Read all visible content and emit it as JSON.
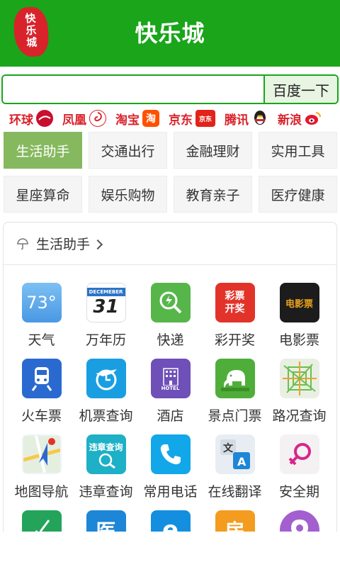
{
  "header": {
    "title": "快乐城",
    "logo_text": [
      "快",
      "乐",
      "城"
    ]
  },
  "search": {
    "value": "",
    "placeholder": "",
    "button_label": "百度一下"
  },
  "quick_links": [
    {
      "label": "环球",
      "icon": "huanqiu-logo-icon"
    },
    {
      "label": "凤凰",
      "icon": "fenghuang-logo-icon"
    },
    {
      "label": "淘宝",
      "icon": "taobao-logo-icon",
      "badge": "淘"
    },
    {
      "label": "京东",
      "icon": "jd-logo-icon",
      "badge": "京东"
    },
    {
      "label": "腾讯",
      "icon": "qq-penguin-icon"
    },
    {
      "label": "新浪",
      "icon": "weibo-logo-icon"
    }
  ],
  "categories": [
    {
      "label": "生活助手",
      "active": true
    },
    {
      "label": "交通出行",
      "active": false
    },
    {
      "label": "金融理财",
      "active": false
    },
    {
      "label": "实用工具",
      "active": false
    },
    {
      "label": "星座算命",
      "active": false
    },
    {
      "label": "娱乐购物",
      "active": false
    },
    {
      "label": "教育亲子",
      "active": false
    },
    {
      "label": "医疗健康",
      "active": false
    }
  ],
  "section": {
    "title": "生活助手",
    "apps": [
      {
        "label": "天气",
        "icon": "weather-icon",
        "icon_text": "73°",
        "color": "#5aa9ec"
      },
      {
        "label": "万年历",
        "icon": "calendar-icon",
        "icon_text": "31",
        "icon_subtext": "DECEMEBER",
        "color": "#ffffff"
      },
      {
        "label": "快递",
        "icon": "express-search-icon",
        "color": "#56b64a"
      },
      {
        "label": "彩开奖",
        "icon": "lottery-icon",
        "icon_text": "彩票开奖",
        "color": "#e2332b"
      },
      {
        "label": "电影票",
        "icon": "movie-ticket-icon",
        "icon_text": "电影票",
        "color": "#1c1c1c"
      },
      {
        "label": "火车票",
        "icon": "train-icon",
        "color": "#2a6ad0"
      },
      {
        "label": "机票查询",
        "icon": "airplane-icon",
        "color": "#1a9ee2"
      },
      {
        "label": "酒店",
        "icon": "hotel-icon",
        "icon_text": "HOTEL",
        "color": "#6f4fb8"
      },
      {
        "label": "景点门票",
        "icon": "elephant-icon",
        "color": "#4fae3a"
      },
      {
        "label": "路况查询",
        "icon": "traffic-map-icon",
        "color": "#e9efe3"
      },
      {
        "label": "地图导航",
        "icon": "map-navigation-icon",
        "color": "#eef4f8"
      },
      {
        "label": "违章查询",
        "icon": "violation-query-icon",
        "icon_text": "违章查询",
        "color": "#1db0c6"
      },
      {
        "label": "常用电话",
        "icon": "phone-icon",
        "color": "#12a7e8"
      },
      {
        "label": "在线翻译",
        "icon": "translate-icon",
        "icon_text": "文A",
        "color": "#e8edf3"
      },
      {
        "label": "安全期",
        "icon": "female-symbol-icon",
        "color": "#f4f1f3"
      },
      {
        "label": "",
        "icon": "broom-icon",
        "color": "#23a45a"
      },
      {
        "label": "",
        "icon": "medical-icon",
        "icon_text": "医",
        "color": "#1d86d6"
      },
      {
        "label": "",
        "icon": "browser-e-icon",
        "icon_text": "e",
        "color": "#148fe0"
      },
      {
        "label": "",
        "icon": "house-icon",
        "icon_text": "房",
        "color": "#f39c1f"
      },
      {
        "label": "",
        "icon": "location-pin-icon",
        "color": "#a35fd0"
      }
    ]
  }
}
